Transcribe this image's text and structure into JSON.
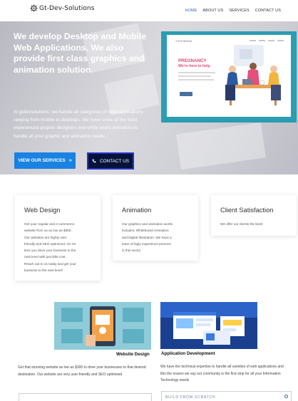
{
  "header": {
    "logo_text": "Gt-Dev-Solutions",
    "nav": [
      "HOME",
      "ABOUT US",
      "SERVICES",
      "CONTACT US"
    ],
    "active_index": 0
  },
  "hero": {
    "title": "We develop Desktop and Mobile Web Applications. We also provide first class graphics and animation solution",
    "description": "At gtdevsolutions, we handle all categories of Web applications ranging from mobile to desktops. We have some of the most experienced graphic designers and white board animators to handle all your graphic and animation needs.",
    "btn_services": "VIEW OUR SERVICES",
    "btn_services_icon": "double-chevron-right-icon",
    "btn_contact": "CONTACT US",
    "btn_contact_icon": "phone-icon",
    "illustration": {
      "brand": "YOUR BRAND",
      "heading1": "PREGNANCY",
      "heading2": "We're here to help"
    }
  },
  "services": [
    {
      "title": "Web Design",
      "lines": [
        "Get your regular and e-commerce",
        "website from us as low as $300.",
        "Our websites are highly user",
        "friendly and SEO optimized. It's it's",
        "time you drive your business to the",
        "next level with just little cost.",
        "Reach out to us today and get your",
        "business to the next level!"
      ]
    },
    {
      "title": "Animation",
      "lines": [
        "Our graphics and animation works",
        "includes; Whiteboard Animation",
        "and Digital Illustration. We have a",
        "team of higly experience persons",
        "in this sector"
      ]
    },
    {
      "title": "Client Satisfaction",
      "lines": [
        "We offer our clients the best!"
      ]
    }
  ],
  "portfolio": [
    {
      "caption": "Website Design",
      "text": "Get that stunning website as low as $300 to drive your businesses to that desired destination. Our website are very user friendly and SEO optimised"
    },
    {
      "caption": "Application Development",
      "text": "We have the technical expertise to handle all varieties of web applications and this the reason we say our community is the first stop for all your Information Technology needs",
      "field_label": "BUILD FROM SCRATCH"
    }
  ],
  "colors": {
    "accent_blue": "#1a82e2",
    "contact_bg": "#05133b",
    "contact_border": "#2436c6",
    "nav_active": "#2f69c4",
    "teal_art": "#2a9db2",
    "pink_text": "#e3476b"
  }
}
